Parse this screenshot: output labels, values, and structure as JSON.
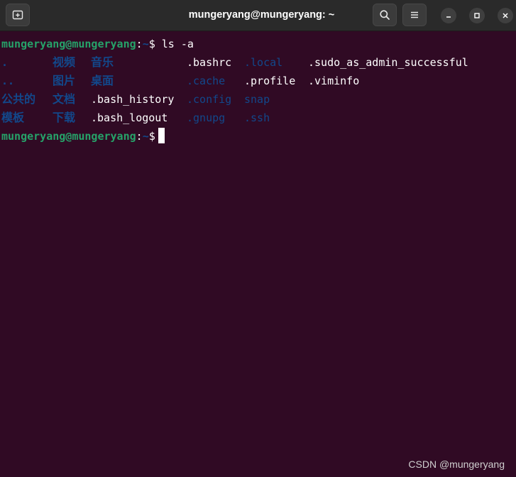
{
  "window": {
    "title": "mungeryang@mungeryang: ~"
  },
  "header": {
    "new_tab_icon": "new-tab-icon",
    "search_icon": "search-icon",
    "menu_icon": "hamburger-menu-icon",
    "minimize_icon": "minimize-icon",
    "maximize_icon": "maximize-icon",
    "close_icon": "close-icon"
  },
  "colors": {
    "background": "#300a24",
    "prompt_user": "#26a269",
    "prompt_path": "#12488b",
    "directory": "#12488b",
    "file": "#ffffff",
    "headerbar": "#2a2a2a"
  },
  "terminal": {
    "prompt1": {
      "user_host": "mungeryang@mungeryang",
      "colon": ":",
      "path": "~",
      "dollar": "$",
      "command": " ls -a"
    },
    "listing": {
      "row1": {
        "c1": ".",
        "c2": "视频",
        "c3": "音乐",
        "c5": ".bashrc",
        "c6": ".local",
        "c7": ".sudo_as_admin_successful"
      },
      "row2": {
        "c1": "..",
        "c2": "图片",
        "c3": "桌面",
        "c5": ".cache",
        "c6": ".profile",
        "c7": ".viminfo"
      },
      "row3": {
        "c1": "公共的",
        "c2": "文档",
        "c4": ".bash_history",
        "c5": ".config",
        "c6": "snap"
      },
      "row4": {
        "c1": "模板",
        "c2": "下载",
        "c4": ".bash_logout",
        "c5": ".gnupg",
        "c6": ".ssh"
      }
    },
    "prompt2": {
      "user_host": "mungeryang@mungeryang",
      "colon": ":",
      "path": "~",
      "dollar": "$"
    }
  },
  "watermark": "CSDN @mungeryang"
}
